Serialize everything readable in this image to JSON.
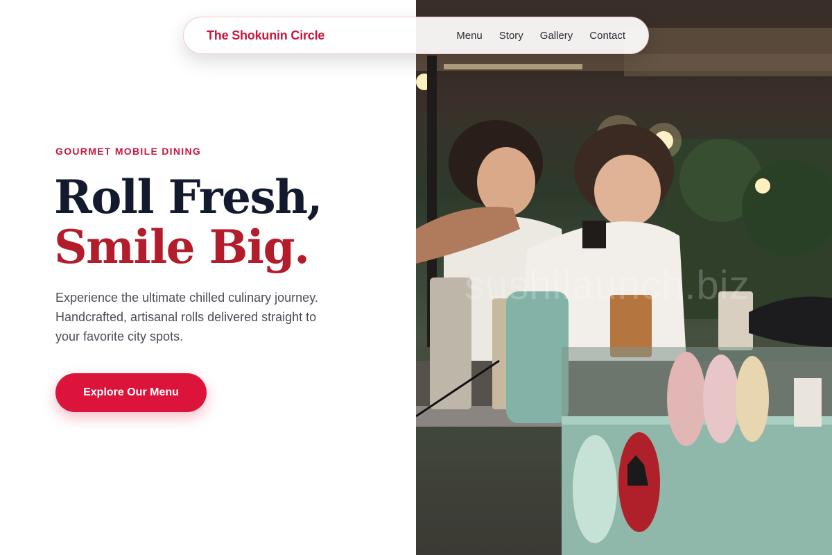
{
  "nav": {
    "brand": "The Shokunin Circle",
    "links": [
      "Menu",
      "Story",
      "Gallery",
      "Contact"
    ]
  },
  "hero": {
    "eyebrow": "GOURMET MOBILE DINING",
    "title_line1": "Roll Fresh,",
    "title_line2": "Smile Big.",
    "description_lines": [
      "Experience the ultimate chilled culinary journey.",
      "Handcrafted, artisanal rolls delivered straight to",
      "your favorite city spots."
    ],
    "cta_label": "Explore Our Menu"
  },
  "photo": {
    "watermark": "sushilaunch.biz"
  },
  "colors": {
    "accent": "#dc143c",
    "brand_text": "#c8173d",
    "heading_dark": "#141a2e",
    "heading_red": "#b31c2a",
    "body_text": "#4a4d57"
  }
}
